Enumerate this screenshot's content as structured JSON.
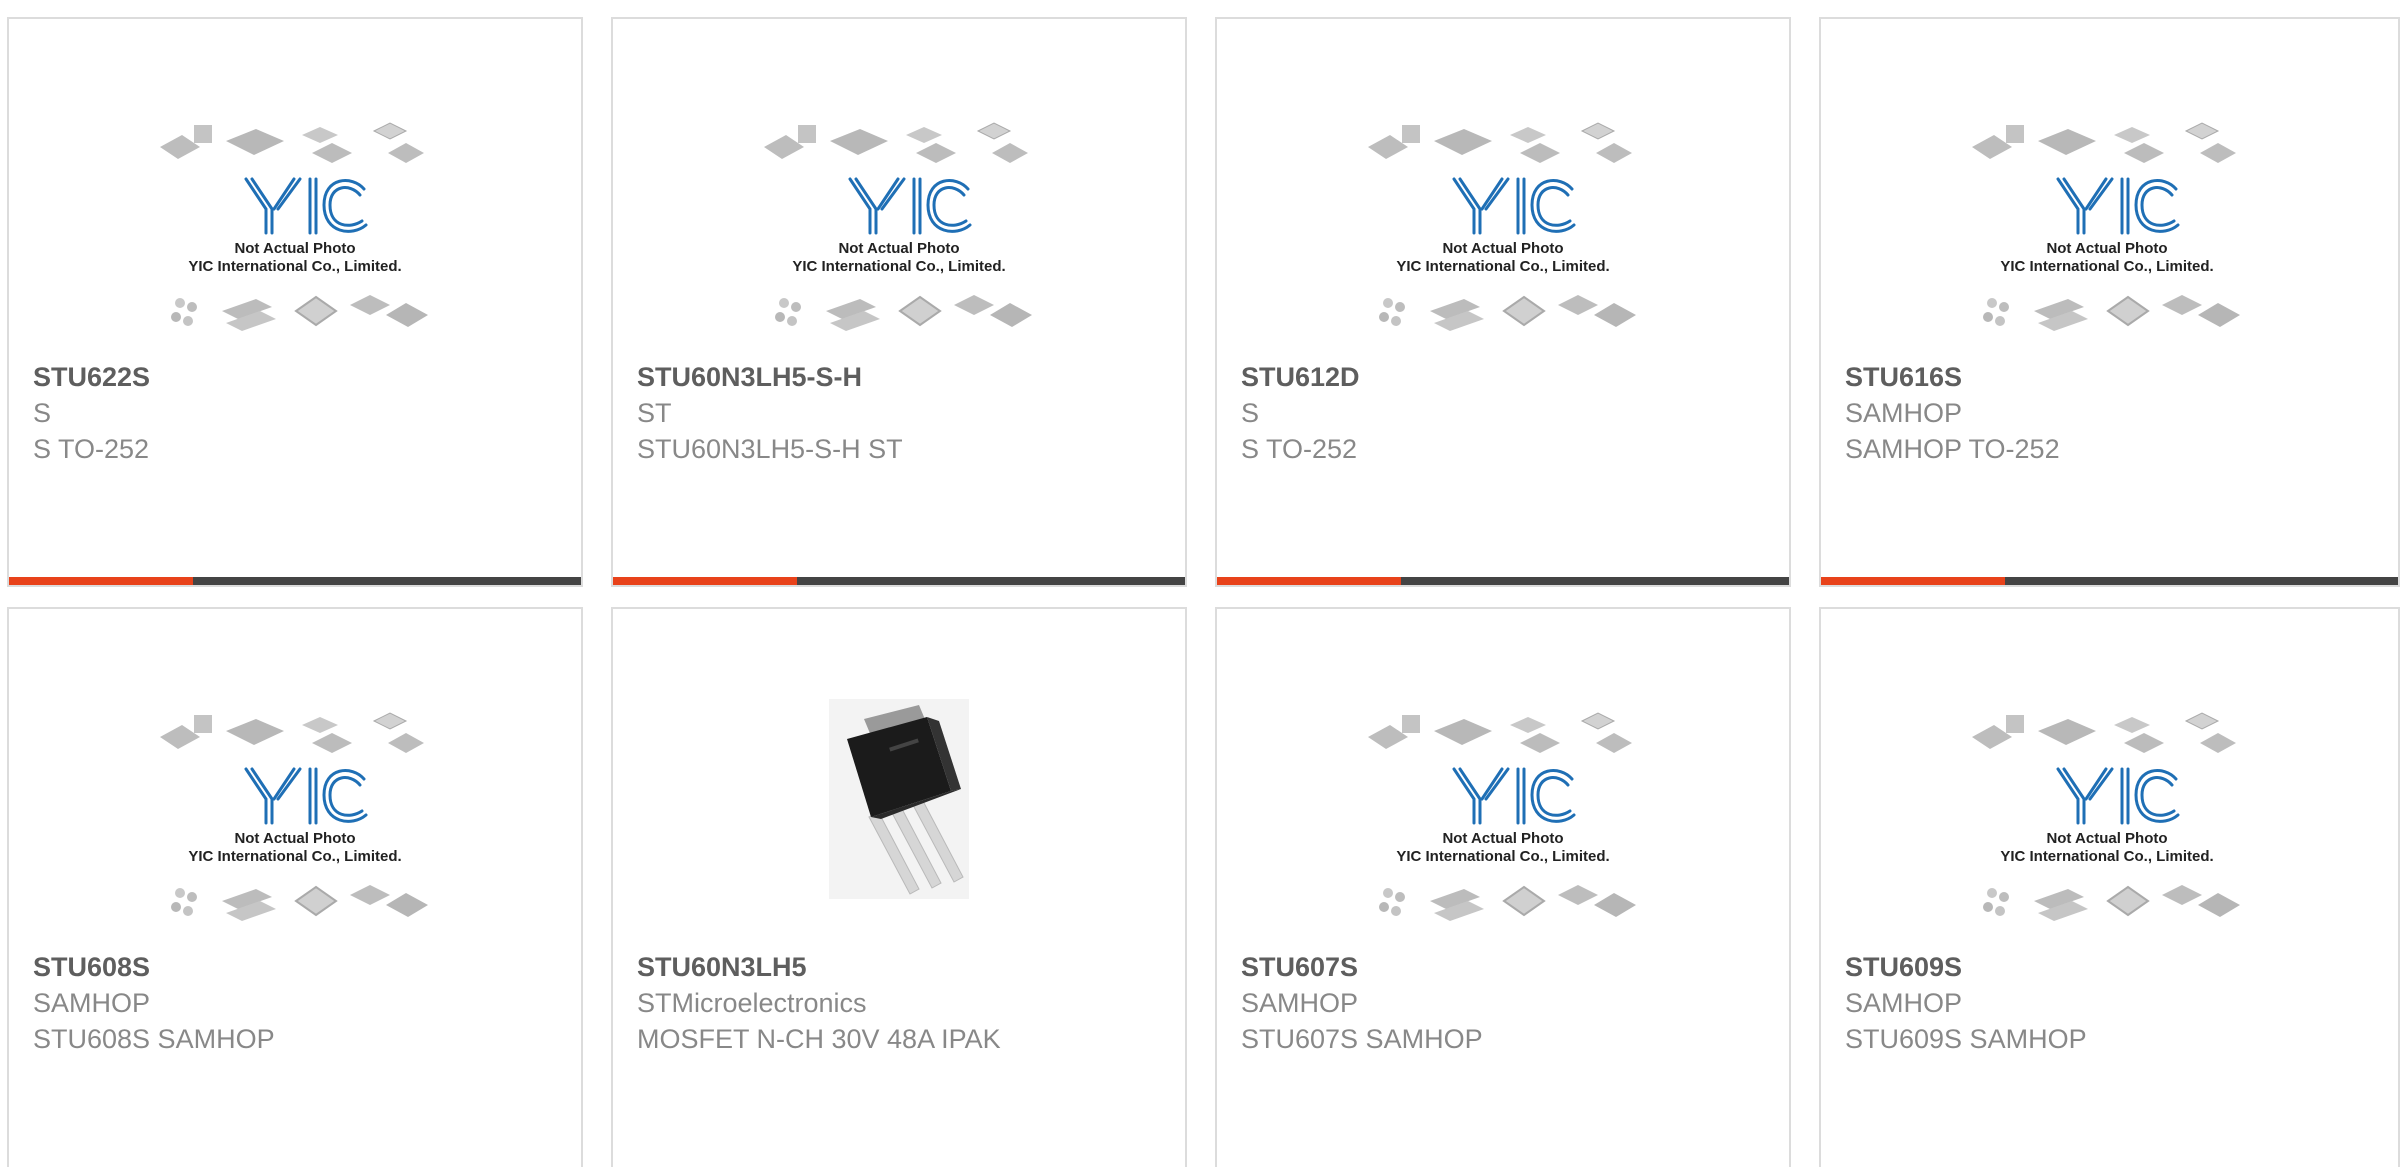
{
  "colors": {
    "accent": "#e8421a",
    "bar": "#444444",
    "logo_blue": "#1f6fb5",
    "part_text": "#5e5e5e",
    "meta_text": "#888888",
    "card_border": "#dcdcdc"
  },
  "placeholder": {
    "line1": "Not Actual Photo",
    "line2": "YIC International Co., Limited."
  },
  "products": [
    {
      "part": "STU622S",
      "mfr": "S",
      "desc": "S TO-252",
      "image": "yic-placeholder-icon"
    },
    {
      "part": "STU60N3LH5-S-H",
      "mfr": "ST",
      "desc": "STU60N3LH5-S-H ST",
      "image": "yic-placeholder-icon"
    },
    {
      "part": "STU612D",
      "mfr": "S",
      "desc": "S TO-252",
      "image": "yic-placeholder-icon"
    },
    {
      "part": "STU616S",
      "mfr": "SAMHOP",
      "desc": "SAMHOP TO-252",
      "image": "yic-placeholder-icon"
    },
    {
      "part": "STU608S",
      "mfr": "SAMHOP",
      "desc": "STU608S SAMHOP",
      "image": "yic-placeholder-icon"
    },
    {
      "part": "STU60N3LH5",
      "mfr": "STMicroelectronics",
      "desc": "MOSFET N-CH 30V 48A IPAK",
      "image": "ipak-transistor-photo"
    },
    {
      "part": "STU607S",
      "mfr": "SAMHOP",
      "desc": "STU607S SAMHOP",
      "image": "yic-placeholder-icon"
    },
    {
      "part": "STU609S",
      "mfr": "SAMHOP",
      "desc": "STU609S SAMHOP",
      "image": "yic-placeholder-icon"
    }
  ]
}
